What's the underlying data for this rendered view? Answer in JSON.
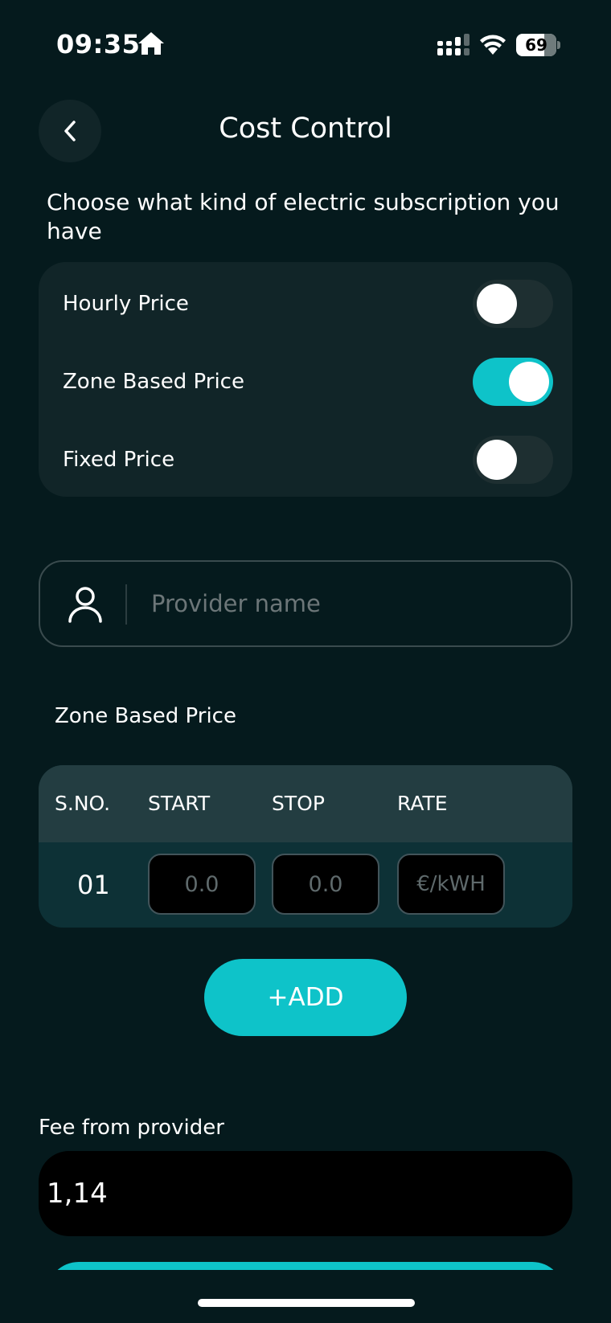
{
  "status_bar": {
    "time": "09:35",
    "battery_level": "69"
  },
  "header": {
    "title": "Cost Control"
  },
  "subscription": {
    "prompt": "Choose what kind of electric subscription you have",
    "options": [
      {
        "label": "Hourly Price",
        "enabled": false
      },
      {
        "label": "Zone Based Price",
        "enabled": true
      },
      {
        "label": "Fixed Price",
        "enabled": false
      }
    ]
  },
  "provider": {
    "placeholder": "Provider name",
    "value": ""
  },
  "zone_table": {
    "title": "Zone Based Price",
    "headers": [
      "S.NO.",
      "START",
      "STOP",
      "RATE"
    ],
    "rows": [
      {
        "sno": "01",
        "start_placeholder": "0.0",
        "stop_placeholder": "0.0",
        "rate_placeholder": "€/kWH"
      }
    ]
  },
  "add_button": {
    "label": "+ADD"
  },
  "fee": {
    "label": "Fee from provider",
    "value": "1,14"
  },
  "colors": {
    "background": "#051a1d",
    "card": "#112528",
    "accent": "#0ec3c9",
    "table_header": "#233d41",
    "table_row": "#0d3136"
  }
}
